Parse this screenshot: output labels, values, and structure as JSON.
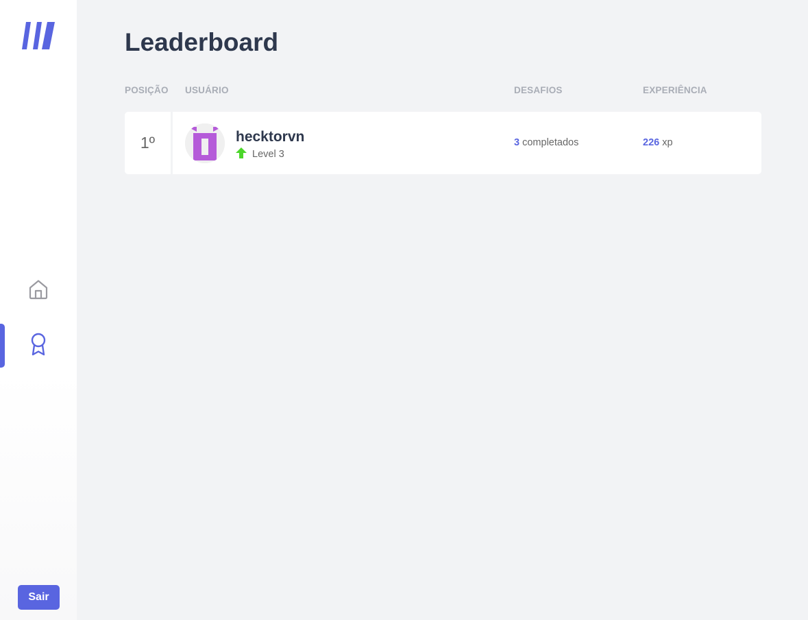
{
  "sidebar": {
    "logo_icon": "app-logo-icon",
    "nav": [
      {
        "icon": "home-icon",
        "active": false
      },
      {
        "icon": "award-icon",
        "active": true
      }
    ],
    "logout_label": "Sair"
  },
  "page": {
    "title": "Leaderboard"
  },
  "table": {
    "columns": [
      "POSIÇÃO",
      "USUÁRIO",
      "DESAFIOS",
      "EXPERIÊNCIA"
    ],
    "rows": [
      {
        "position": "1º",
        "username": "hecktorvn",
        "level": "Level 3",
        "challenges_count": "3",
        "challenges_label": "completados",
        "xp": "226",
        "xp_unit": "xp"
      }
    ]
  },
  "colors": {
    "accent": "#5965e0",
    "level_up": "#4cd62b",
    "avatar": "#b55bd9"
  }
}
